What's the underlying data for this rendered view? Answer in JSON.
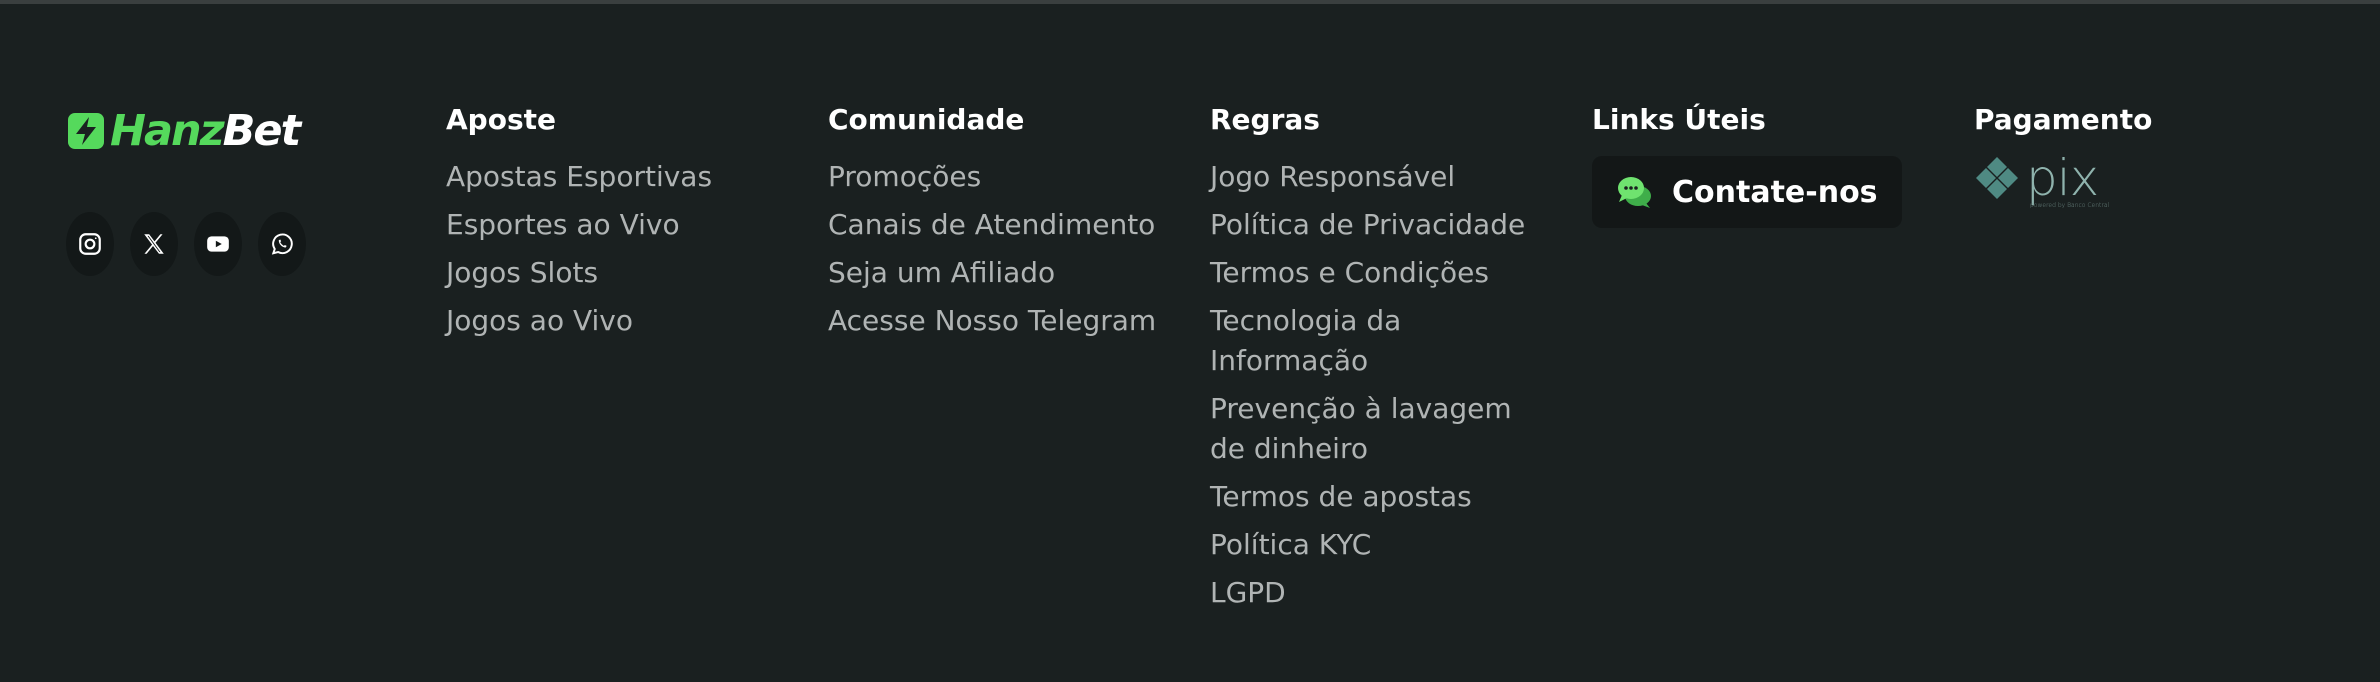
{
  "brand": {
    "logo_part1": "Hanz",
    "logo_part2": "Bet",
    "colors": {
      "accent": "#55d95c",
      "background": "#1a2020",
      "link": "#b0b4b4",
      "heading": "#ffffff"
    },
    "socials": [
      {
        "icon": "instagram-icon"
      },
      {
        "icon": "x-twitter-icon"
      },
      {
        "icon": "youtube-icon"
      },
      {
        "icon": "whatsapp-icon"
      }
    ]
  },
  "columns": {
    "aposte": {
      "title": "Aposte",
      "items": [
        "Apostas Esportivas",
        "Esportes ao Vivo",
        "Jogos Slots",
        "Jogos ao Vivo"
      ]
    },
    "comunidade": {
      "title": "Comunidade",
      "items": [
        "Promoções",
        "Canais de Atendimento",
        "Seja um Afiliado",
        "Acesse Nosso Telegram"
      ]
    },
    "regras": {
      "title": "Regras",
      "items": [
        "Jogo Responsável",
        "Política de Privacidade",
        "Termos e Condições",
        "Tecnologia da Informação",
        "Prevenção à lavagem de dinheiro",
        "Termos de apostas",
        "Política KYC",
        "LGPD"
      ]
    },
    "links": {
      "title": "Links Úteis",
      "contact_label": "Contate-nos",
      "contact_icon": "chat-bubbles-icon"
    },
    "pagamento": {
      "title": "Pagamento",
      "pix_word": "pix",
      "pix_sub": "powered by Banco Central"
    }
  }
}
